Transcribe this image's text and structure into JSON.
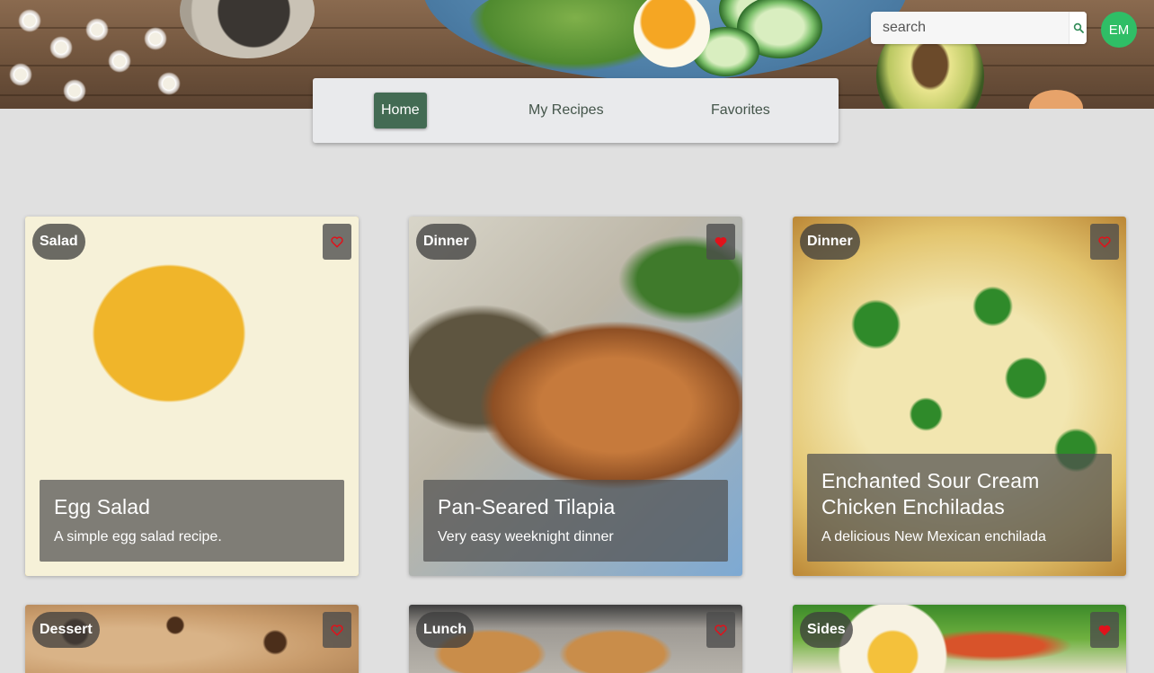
{
  "search": {
    "placeholder": "search"
  },
  "user": {
    "initials": "EM"
  },
  "colors": {
    "accent": "#436b53",
    "avatar": "#2fbe66",
    "favorite_red": "#e0121b"
  },
  "nav": {
    "items": [
      {
        "label": "Home",
        "active": true
      },
      {
        "label": "My Recipes",
        "active": false
      },
      {
        "label": "Favorites",
        "active": false
      }
    ]
  },
  "recipes": [
    {
      "category": "Salad",
      "title": "Egg Salad",
      "description": "A simple egg salad recipe.",
      "favorited": false
    },
    {
      "category": "Dinner",
      "title": "Pan-Seared Tilapia",
      "description": "Very easy weeknight dinner",
      "favorited": true
    },
    {
      "category": "Dinner",
      "title": "Enchanted Sour Cream Chicken Enchiladas",
      "description": "A delicious New Mexican enchilada",
      "favorited": false
    },
    {
      "category": "Dessert",
      "favorited": false
    },
    {
      "category": "Lunch",
      "favorited": false
    },
    {
      "category": "Sides",
      "favorited": true
    }
  ],
  "icons": {
    "search": "search-icon",
    "favorite": "heart-icon"
  }
}
